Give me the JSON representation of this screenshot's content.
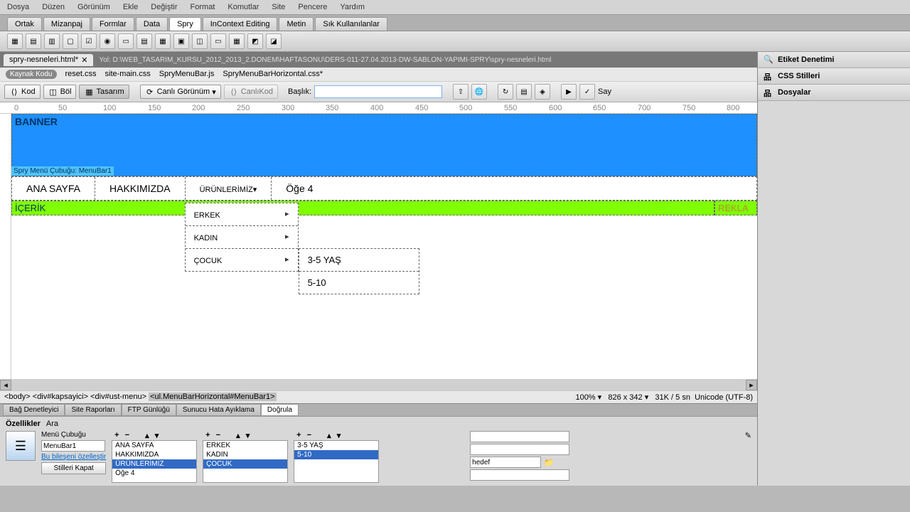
{
  "menubar": [
    "Dosya",
    "Düzen",
    "Görünüm",
    "Ekle",
    "Değiştir",
    "Format",
    "Komutlar",
    "Site",
    "Pencere",
    "Yardım"
  ],
  "insertTabs": [
    "Ortak",
    "Mizanpaj",
    "Formlar",
    "Data",
    "Spry",
    "InContext Editing",
    "Metin",
    "Sık Kullanılanlar"
  ],
  "activeInsertTab": 4,
  "docTab": "spry-nesneleri.html*",
  "docPath": "Yol:  D:\\WEB_TASARIM_KURSU_2012_2013_2.DONEM\\HAFTASONU\\DERS-011-27.04.2013-DW-SABLON-YAPIMI-SPRY\\spry-nesneleri.html",
  "sourceBar": {
    "kaynak": "Kaynak Kodu",
    "files": [
      "reset.css",
      "site-main.css",
      "SpryMenuBar.js",
      "SpryMenuBarHorizontal.css*"
    ]
  },
  "viewBar": {
    "kod": "Kod",
    "bol": "Böl",
    "tasarim": "Tasarım",
    "canli": "Canlı Görünüm",
    "canlikod": "CanlıKod",
    "baslik": "Başlık:",
    "say": "Say"
  },
  "rulerTicks": [
    0,
    50,
    100,
    150,
    200,
    250,
    300,
    350,
    400,
    450,
    500,
    550,
    600,
    650,
    700,
    750,
    800
  ],
  "canvas": {
    "banner": "BANNER",
    "spryLabel": "Spry Menü Çubuğu: MenuBar1",
    "nav": [
      "ANA SAYFA",
      "HAKKIMIZDA",
      "ÜRÜNLERİMİZ",
      "Öğe 4"
    ],
    "sub": [
      "ERKEK",
      "KADIN",
      "ÇOCUK"
    ],
    "sub2": [
      "3-5 YAŞ",
      "5-10"
    ],
    "icerik": "İÇERİK",
    "reklam": "REKLA"
  },
  "tagPath": {
    "tags": [
      "<body>",
      "<div#kapsayici>",
      "<div#ust-menu>",
      "<ul.MenuBarHorizontal#MenuBar1>"
    ],
    "zoom": "100%",
    "dims": "826 x 342",
    "size": "31K / 5 sn",
    "enc": "Unicode (UTF-8)"
  },
  "bottomTabs": [
    "Bağ Denetleyici",
    "Site Raporları",
    "FTP Günlüğü",
    "Sunucu Hata Ayıklama",
    "Doğrula"
  ],
  "propTabs": [
    "Özellikler",
    "Ara"
  ],
  "prop": {
    "label": "Menü Çubuğu",
    "id": "MenuBar1",
    "link": "Bu bileşeni özelleştir",
    "closeBtn": "Stilleri Kapat",
    "list1": [
      "ANA SAYFA",
      "HAKKIMIZDA",
      "ÜRÜNLERİMİZ",
      "Öğe 4"
    ],
    "sel1": 2,
    "list2": [
      "ERKEK",
      "KADIN",
      "ÇOCUK"
    ],
    "sel2": 2,
    "list3": [
      "3-5 YAŞ",
      "5-10"
    ],
    "sel3": 1,
    "hedef": "hedef"
  },
  "panels": {
    "etiket": "Etiket Denetimi",
    "css": "CSS Stilleri",
    "dosya": "Dosyalar"
  }
}
